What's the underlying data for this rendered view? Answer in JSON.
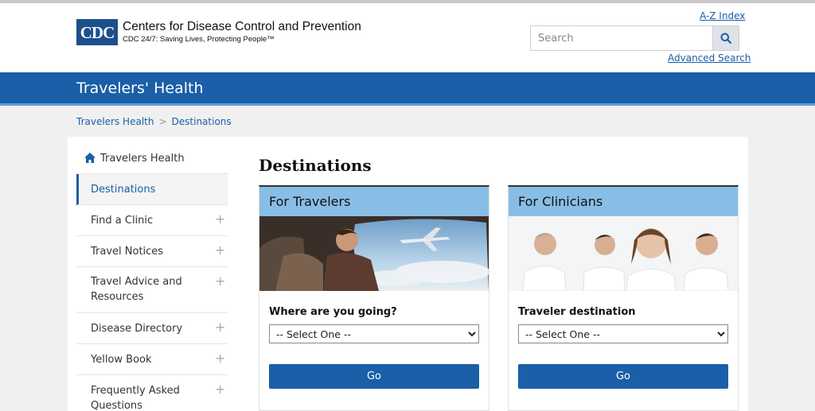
{
  "header": {
    "logo_text": "CDC",
    "org_name": "Centers for Disease Control and Prevention",
    "tagline": "CDC 24/7: Saving Lives, Protecting People™",
    "az_index": "A-Z Index",
    "search_placeholder": "Search",
    "advanced_search": "Advanced Search"
  },
  "banner": {
    "title": "Travelers' Health"
  },
  "breadcrumb": {
    "items": [
      "Travelers Health",
      "Destinations"
    ],
    "separator": ">"
  },
  "sidenav": {
    "home_label": "Travelers Health",
    "items": [
      {
        "label": "Destinations",
        "expandable": false,
        "active": true
      },
      {
        "label": "Find a Clinic",
        "expandable": true
      },
      {
        "label": "Travel Notices",
        "expandable": true
      },
      {
        "label": "Travel Advice and Resources",
        "expandable": true
      },
      {
        "label": "Disease Directory",
        "expandable": true
      },
      {
        "label": "Yellow Book",
        "expandable": true
      },
      {
        "label": "Frequently Asked Questions",
        "expandable": true
      }
    ],
    "plus_symbol": "+"
  },
  "main": {
    "title": "Destinations",
    "cards": [
      {
        "heading": "For Travelers",
        "image": "traveler-on-airplane",
        "field_label": "Where are you going?",
        "select_value": "-- Select One --",
        "button": "Go"
      },
      {
        "heading": "For Clinicians",
        "image": "group-of-doctors",
        "field_label": "Traveler destination",
        "select_value": "-- Select One --",
        "button": "Go"
      }
    ]
  },
  "colors": {
    "brand_blue": "#1a5fa8",
    "logo_blue": "#1d4f8c",
    "card_header_blue": "#88bde6",
    "link_blue": "#1a5da8"
  },
  "icons": {
    "home": "home-icon",
    "search": "search-icon",
    "dropdown": "chevron-down-icon"
  }
}
